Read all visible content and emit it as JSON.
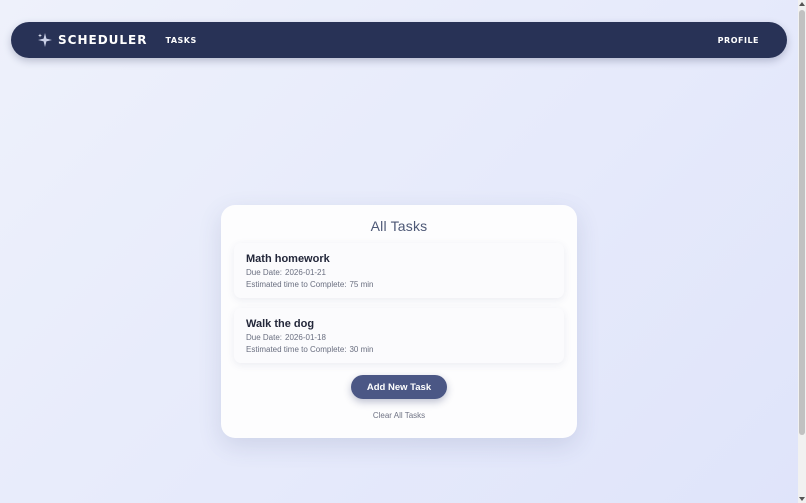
{
  "navbar": {
    "brand": "SCHEDULER",
    "brand_icon": "sparkle-icon",
    "links": {
      "tasks": "TASKS",
      "profile": "PROFILE"
    }
  },
  "tasks_card": {
    "title": "All Tasks",
    "tasks": [
      {
        "name": "Math homework",
        "due_label": "Due Date:",
        "due_date": "2026-01-21",
        "estimate_label": "Estimated time to Complete:",
        "estimate": "75 min"
      },
      {
        "name": "Walk the dog",
        "due_label": "Due Date:",
        "due_date": "2026-01-18",
        "estimate_label": "Estimated time to Complete:",
        "estimate": "30 min"
      }
    ],
    "add_button": "Add New Task",
    "clear_link": "Clear All Tasks"
  },
  "colors": {
    "navbar_bg": "#283256",
    "button_bg": "#4b5785",
    "page_bg": "#e6eafb"
  }
}
